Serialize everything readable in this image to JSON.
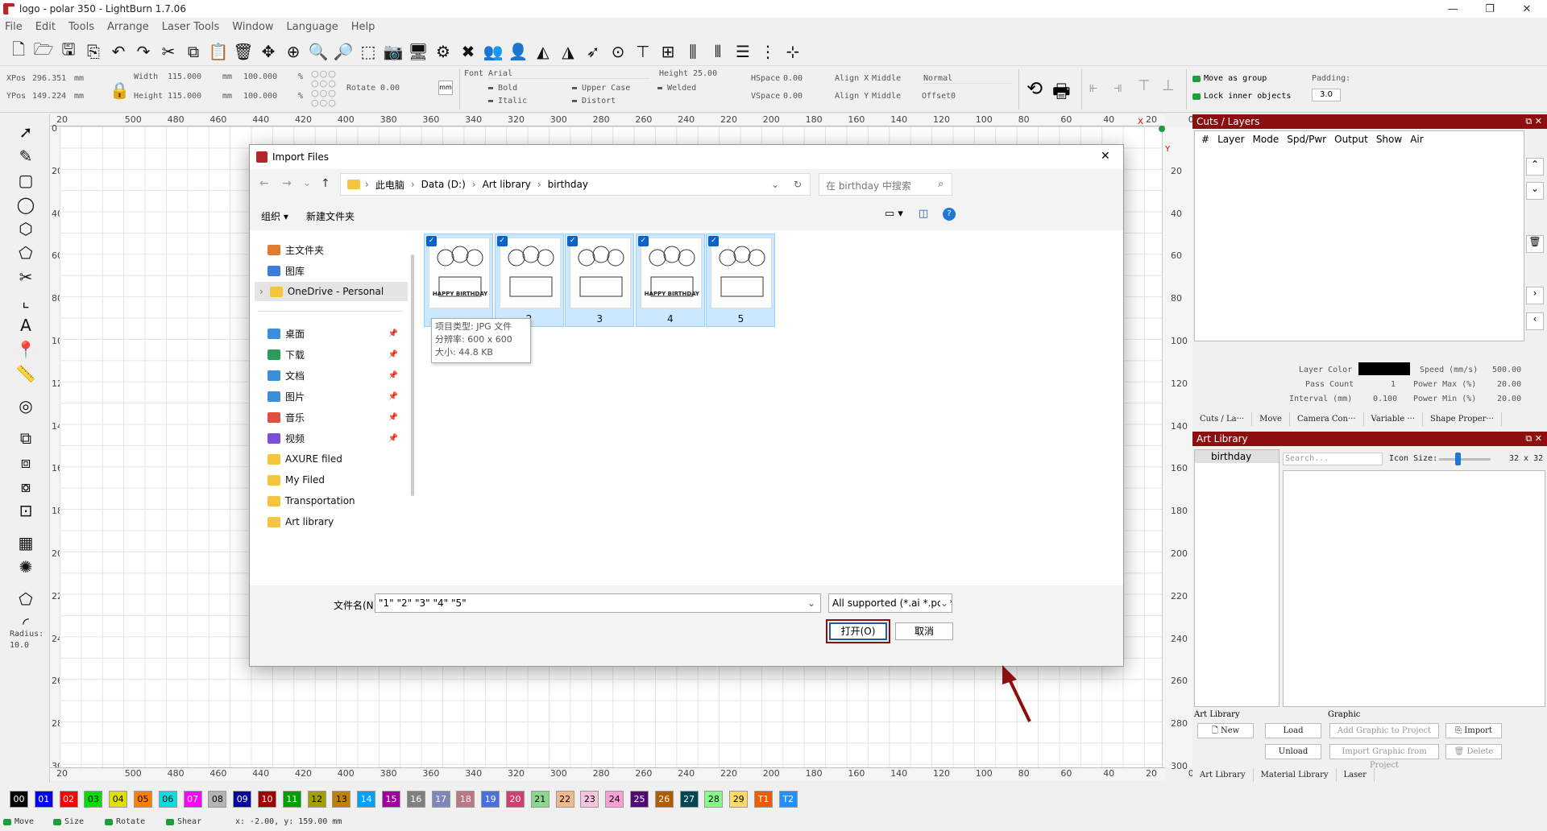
{
  "window": {
    "title": "logo - polar 350 - LightBurn 1.7.06",
    "min": "—",
    "max": "❐",
    "close": "✕"
  },
  "menu": [
    "File",
    "Edit",
    "Tools",
    "Arrange",
    "Laser Tools",
    "Window",
    "Language",
    "Help"
  ],
  "toolbar": {
    "xpos_label": "XPos",
    "xpos_value": "296.351",
    "ypos_label": "YPos",
    "ypos_value": "149.224",
    "unit_mm": "mm",
    "width_label": "Width",
    "width_value": "115.000",
    "height_label": "Height",
    "height_value": "115.000",
    "percent_w": "100.000",
    "percent_h": "100.000",
    "percent_sign": "%",
    "rotate_label": "Rotate",
    "rotate_value": "0.00",
    "mm_button": "mm",
    "font_label": "Font",
    "font_value": "Arial",
    "text_height_label": "Height",
    "text_height_value": "25.00",
    "bold": "Bold",
    "italic": "Italic",
    "upper_case": "Upper Case",
    "distort": "Distort",
    "welded": "Welded",
    "hspace_label": "HSpace",
    "hspace_value": "0.00",
    "vspace_label": "VSpace",
    "vspace_value": "0.00",
    "align_x_label": "Align X",
    "align_x_value": "Middle",
    "align_y_label": "Align Y",
    "align_y_value": "Middle",
    "normal": "Normal",
    "offset_label": "Offset",
    "offset_value": "0",
    "move_as_group": "Move as group",
    "lock_inner": "Lock inner objects",
    "padding_label": "Padding:",
    "padding_value": "3.0"
  },
  "rulers": {
    "top": [
      "20",
      "500",
      "480",
      "460",
      "440",
      "420",
      "400",
      "380",
      "360",
      "340",
      "320",
      "300",
      "280",
      "260",
      "240",
      "220",
      "200",
      "180",
      "160",
      "140",
      "120",
      "100",
      "80",
      "60",
      "40",
      "20",
      "0"
    ],
    "left": [
      "0",
      "20",
      "40",
      "60",
      "80",
      "100",
      "120",
      "140",
      "160",
      "180",
      "200",
      "220",
      "240",
      "260",
      "280",
      "300"
    ],
    "x_marker": "X",
    "y_marker": "Y"
  },
  "left_tools": {
    "radius_label": "Radius:",
    "radius_value": "10.0"
  },
  "cuts_layers": {
    "title": "Cuts / Layers",
    "columns": [
      "#",
      "Layer",
      "Mode",
      "Spd/Pwr",
      "Output",
      "Show",
      "Air"
    ],
    "layer_color": "Layer Color",
    "speed_label": "Speed (mm/s)",
    "speed_value": "500.00",
    "pass_count_label": "Pass Count",
    "pass_count_value": "1",
    "power_max_label": "Power Max (%)",
    "power_max_value": "20.00",
    "interval_label": "Interval (mm)",
    "interval_value": "0.100",
    "power_min_label": "Power Min (%)",
    "power_min_value": "20.00",
    "tabs": [
      "Cuts / La···",
      "Move",
      "Camera Con···",
      "Variable ···",
      "Shape Proper···"
    ]
  },
  "art_library": {
    "title": "Art Library",
    "folder": "birthday",
    "search_placeholder": "Search...",
    "icon_size_label": "Icon Size:",
    "icon_size_value": "32 x 32",
    "section_lib": "Art Library",
    "section_graphic": "Graphic",
    "new": "New",
    "load": "Load",
    "unload": "Unload",
    "add_graphic": "Add Graphic to Project",
    "import": "Import",
    "import_graphic": "Import Graphic from Project",
    "delete": "Delete",
    "tabs": [
      "Art Library",
      "Material Library",
      "Laser"
    ]
  },
  "palette": [
    {
      "label": "00",
      "color": "#000000",
      "text": "#ffffff"
    },
    {
      "label": "01",
      "color": "#0000ff",
      "text": "#ffffff"
    },
    {
      "label": "02",
      "color": "#ff0000",
      "text": "#ffffff"
    },
    {
      "label": "03",
      "color": "#00e000",
      "text": "#000000"
    },
    {
      "label": "04",
      "color": "#e0e000",
      "text": "#000000"
    },
    {
      "label": "05",
      "color": "#ff8000",
      "text": "#000000"
    },
    {
      "label": "06",
      "color": "#00e0e0",
      "text": "#000000"
    },
    {
      "label": "07",
      "color": "#ff00ff",
      "text": "#ffffff"
    },
    {
      "label": "08",
      "color": "#b4b4b4",
      "text": "#000000"
    },
    {
      "label": "09",
      "color": "#0000a0",
      "text": "#ffffff"
    },
    {
      "label": "10",
      "color": "#a00000",
      "text": "#ffffff"
    },
    {
      "label": "11",
      "color": "#00a000",
      "text": "#ffffff"
    },
    {
      "label": "12",
      "color": "#a0a000",
      "text": "#000000"
    },
    {
      "label": "13",
      "color": "#c08000",
      "text": "#000000"
    },
    {
      "label": "14",
      "color": "#00a0ff",
      "text": "#ffffff"
    },
    {
      "label": "15",
      "color": "#a000a0",
      "text": "#ffffff"
    },
    {
      "label": "16",
      "color": "#808080",
      "text": "#ffffff"
    },
    {
      "label": "17",
      "color": "#7d87b9",
      "text": "#ffffff"
    },
    {
      "label": "18",
      "color": "#bb7784",
      "text": "#ffffff"
    },
    {
      "label": "19",
      "color": "#4a6fe3",
      "text": "#ffffff"
    },
    {
      "label": "20",
      "color": "#d33f6a",
      "text": "#ffffff"
    },
    {
      "label": "21",
      "color": "#8cd78c",
      "text": "#000000"
    },
    {
      "label": "22",
      "color": "#f0b98d",
      "text": "#000000"
    },
    {
      "label": "23",
      "color": "#f6c4e1",
      "text": "#000000"
    },
    {
      "label": "24",
      "color": "#fa9ed4",
      "text": "#000000"
    },
    {
      "label": "25",
      "color": "#500a78",
      "text": "#ffffff"
    },
    {
      "label": "26",
      "color": "#b45a00",
      "text": "#ffffff"
    },
    {
      "label": "27",
      "color": "#004754",
      "text": "#ffffff"
    },
    {
      "label": "28",
      "color": "#86fa88",
      "text": "#000000"
    },
    {
      "label": "29",
      "color": "#ffdb66",
      "text": "#000000"
    },
    {
      "label": "T1",
      "color": "#f35a00",
      "text": "#ffffff"
    },
    {
      "label": "T2",
      "color": "#1e90ff",
      "text": "#ffffff"
    }
  ],
  "status": {
    "move": "Move",
    "size": "Size",
    "rotate": "Rotate",
    "shear": "Shear",
    "coords": "x: -2.00, y: 159.00 mm"
  },
  "dialog": {
    "title": "Import Files",
    "breadcrumb": [
      "此电脑",
      "Data (D:)",
      "Art library",
      "birthday"
    ],
    "search_placeholder": "在 birthday 中搜索",
    "organize": "组织",
    "new_folder": "新建文件夹",
    "sidebar": [
      {
        "label": "主文件夹",
        "pinned": false
      },
      {
        "label": "图库",
        "pinned": false
      },
      {
        "label": "OneDrive - Personal",
        "pinned": false
      },
      {
        "label": "桌面",
        "pinned": true
      },
      {
        "label": "下载",
        "pinned": true
      },
      {
        "label": "文档",
        "pinned": true
      },
      {
        "label": "图片",
        "pinned": true
      },
      {
        "label": "音乐",
        "pinned": true
      },
      {
        "label": "视频",
        "pinned": true
      },
      {
        "label": "AXURE filed",
        "pinned": false
      },
      {
        "label": "My Filed",
        "pinned": false
      },
      {
        "label": "Transportation",
        "pinned": false
      },
      {
        "label": "Art library",
        "pinned": false
      }
    ],
    "files": [
      {
        "name": "1",
        "art": "HAPPY BIRTHDAY"
      },
      {
        "name": "2",
        "art": ""
      },
      {
        "name": "3",
        "art": ""
      },
      {
        "name": "4",
        "art": "HAPPY BIRTHDAY"
      },
      {
        "name": "5",
        "art": ""
      }
    ],
    "tooltip": {
      "type": "项目类型: JPG 文件",
      "resolution": "分辨率: 600 x 600",
      "size": "大小: 44.8 KB"
    },
    "filename_label": "文件名(N):",
    "filename_value": "\"1\" \"2\" \"3\" \"4\" \"5\"",
    "filetype": "All supported (*.ai *.pdf *.sc",
    "open": "打开(O)",
    "cancel": "取消"
  }
}
